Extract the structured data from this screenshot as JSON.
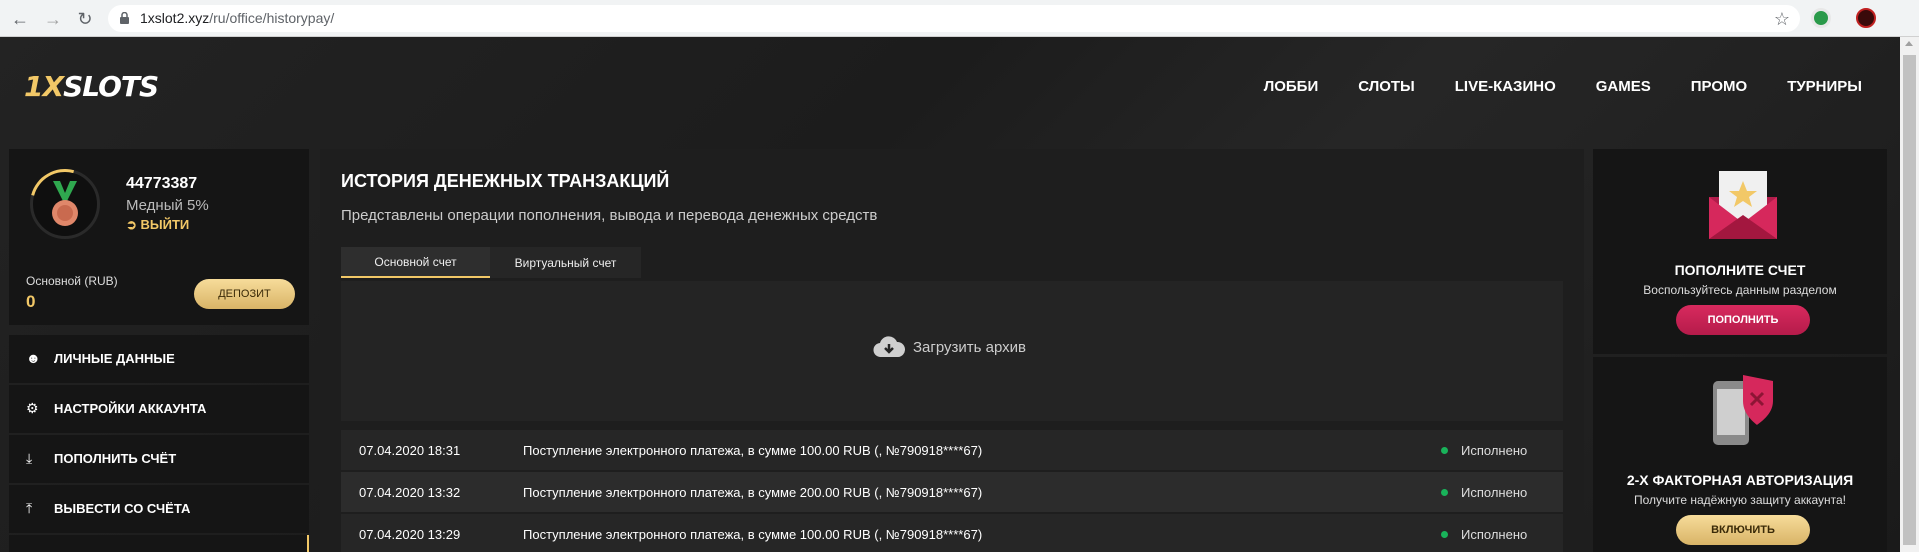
{
  "browser": {
    "url_host": "1xslot2.xyz",
    "url_path": "/ru/office/historypay/"
  },
  "header": {
    "logo_prefix": "1X",
    "logo_suffix": "SLOTS",
    "nav": [
      "ЛОББИ",
      "СЛОТЫ",
      "LIVE-КАЗИНО",
      "GAMES",
      "ПРОМО",
      "ТУРНИРЫ"
    ]
  },
  "profile": {
    "user_id": "44773387",
    "level": "Медный 5%",
    "logout_label": "ВЫЙТИ",
    "balance_label": "Основной (RUB)",
    "balance_value": "0",
    "deposit_label": "ДЕПОЗИТ"
  },
  "sidebar": {
    "items": [
      {
        "label": "ЛИЧНЫЕ ДАННЫЕ",
        "icon": "user-plus-icon"
      },
      {
        "label": "НАСТРОЙКИ АККАУНТА",
        "icon": "gears-icon"
      },
      {
        "label": "ПОПОЛНИТЬ СЧЁТ",
        "icon": "download-icon"
      },
      {
        "label": "ВЫВЕСТИ СО СЧЁТА",
        "icon": "upload-icon"
      }
    ]
  },
  "main": {
    "title": "ИСТОРИЯ ДЕНЕЖНЫХ ТРАНЗАКЦИЙ",
    "subtitle": "Представлены операции пополнения, вывода и перевода денежных средств",
    "tabs": [
      {
        "label": "Основной счет",
        "active": true
      },
      {
        "label": "Виртуальный счет",
        "active": false
      }
    ],
    "archive_label": "Загрузить архив",
    "transactions": [
      {
        "date": "07.04.2020 18:31",
        "description": "Поступление электронного платежа, в сумме 100.00 RUB (, №790918****67)",
        "status": "Исполнено"
      },
      {
        "date": "07.04.2020 13:32",
        "description": "Поступление электронного платежа, в сумме 200.00 RUB (, №790918****67)",
        "status": "Исполнено"
      },
      {
        "date": "07.04.2020 13:29",
        "description": "Поступление электронного платежа, в сумме 100.00 RUB (, №790918****67)",
        "status": "Исполнено"
      }
    ]
  },
  "promos": {
    "deposit": {
      "title": "ПОПОЛНИТЕ СЧЕТ",
      "text": "Воспользуйтесь данным разделом",
      "button": "ПОПОЛНИТЬ"
    },
    "twofa": {
      "title": "2-Х ФАКТОРНАЯ АВТОРИЗАЦИЯ",
      "text": "Получите надёжную защиту аккаунта!",
      "button": "ВКЛЮЧИТЬ"
    }
  },
  "colors": {
    "accent_gold": "#f2c867",
    "accent_pink": "#c8204f",
    "status_success": "#19b35a"
  }
}
